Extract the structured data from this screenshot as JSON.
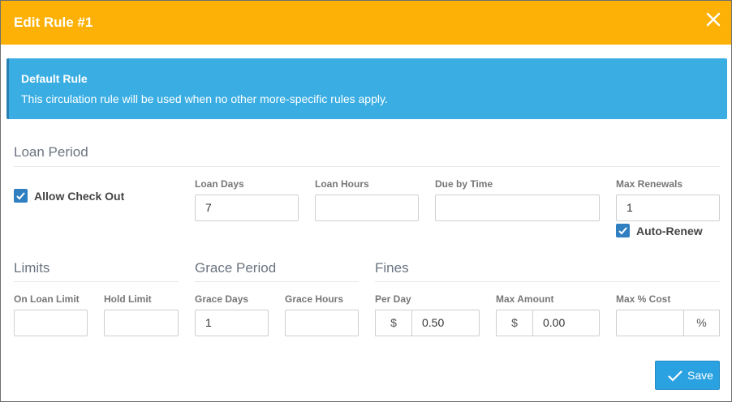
{
  "modal": {
    "title": "Edit Rule #1"
  },
  "alert": {
    "title": "Default Rule",
    "text": "This circulation rule will be used when no other more-specific rules apply."
  },
  "loan_period": {
    "title": "Loan Period",
    "allow_checkout": {
      "label": "Allow Check Out",
      "checked": true
    },
    "loan_days": {
      "label": "Loan Days",
      "value": "7"
    },
    "loan_hours": {
      "label": "Loan Hours",
      "value": ""
    },
    "due_by_time": {
      "label": "Due by Time",
      "value": ""
    },
    "max_renewals": {
      "label": "Max Renewals",
      "value": "1"
    },
    "auto_renew": {
      "label": "Auto-Renew",
      "checked": true
    }
  },
  "limits": {
    "title": "Limits",
    "on_loan_limit": {
      "label": "On Loan Limit",
      "value": ""
    },
    "hold_limit": {
      "label": "Hold Limit",
      "value": ""
    }
  },
  "grace_period": {
    "title": "Grace Period",
    "grace_days": {
      "label": "Grace Days",
      "value": "1"
    },
    "grace_hours": {
      "label": "Grace Hours",
      "value": ""
    }
  },
  "fines": {
    "title": "Fines",
    "per_day": {
      "label": "Per Day",
      "prefix": "$",
      "value": "0.50"
    },
    "max_amount": {
      "label": "Max Amount",
      "prefix": "$",
      "value": "0.00"
    },
    "max_pct_cost": {
      "label": "Max % Cost",
      "suffix": "%",
      "value": ""
    }
  },
  "footer": {
    "save_label": "Save"
  },
  "colors": {
    "header": "#fdb106",
    "alert": "#3aaee3",
    "checkbox": "#2f7fc1",
    "save_button": "#2aa2e1"
  },
  "icons": {
    "close": "close-icon",
    "check": "check-icon",
    "save": "checkmark-icon"
  }
}
